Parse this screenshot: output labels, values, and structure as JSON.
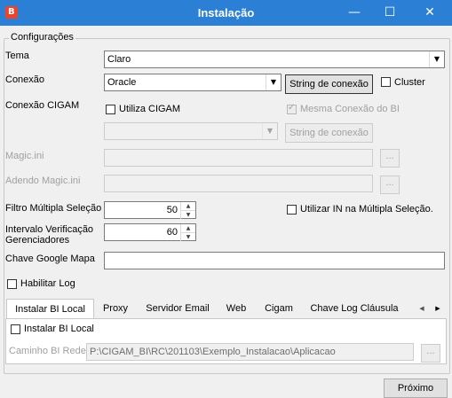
{
  "window": {
    "app_icon_letter": "B",
    "title": "Instalação",
    "minimize_glyph": "—",
    "maximize_glyph": "☐",
    "close_glyph": "✕"
  },
  "config": {
    "legend": "Configurações",
    "tema": {
      "label": "Tema",
      "value": "Claro"
    },
    "conexao": {
      "label": "Conexão",
      "value": "Oracle",
      "string_button": "String de conexão",
      "cluster_label": "Cluster",
      "cluster_checked": false
    },
    "conexao_cigam": {
      "label": "Conexão CIGAM",
      "utiliza_label": "Utiliza CIGAM",
      "utiliza_checked": false,
      "mesma_label": "Mesma Conexão do BI",
      "mesma_checked": true,
      "combo_value": "",
      "string_button": "String de conexão"
    },
    "magic": {
      "label": "Magic.ini",
      "value": "",
      "browse": "..."
    },
    "adendo": {
      "label": "Adendo Magic.ini",
      "value": "",
      "browse": "..."
    },
    "filtro": {
      "label": "Filtro Múltipla Seleção",
      "value": "50",
      "utilizar_in_label": "Utilizar IN na Múltipla Seleção.",
      "utilizar_in_checked": false
    },
    "intervalo": {
      "label_line1": "Intervalo Verificação",
      "label_line2": "Gerenciadores",
      "value": "60"
    },
    "google": {
      "label": "Chave Google Mapa",
      "value": ""
    },
    "habilitar_log": {
      "label": "Habilitar Log",
      "checked": false
    }
  },
  "tabs": {
    "items": [
      "Instalar BI Local",
      "Proxy",
      "Servidor Email",
      "Web",
      "Cigam",
      "Chave Log Cláusula"
    ],
    "active": "Instalar BI Local",
    "scroll_left": "◀",
    "scroll_right": "▶",
    "panel": {
      "instalar_label": "Instalar BI Local",
      "instalar_checked": false,
      "caminho_label": "Caminho BI Rede",
      "caminho_value": "P:\\CIGAM_BI\\RC\\201103\\Exemplo_Instalacao\\Aplicacao",
      "browse": "..."
    }
  },
  "footer": {
    "next_button": "Próximo"
  },
  "icons": {
    "dropdown": "chevron-down-icon",
    "spin_up": "arrow-up-icon",
    "spin_down": "arrow-down-icon"
  },
  "colors": {
    "titlebar": "#2b7fd4",
    "app_icon": "#e8452c"
  }
}
